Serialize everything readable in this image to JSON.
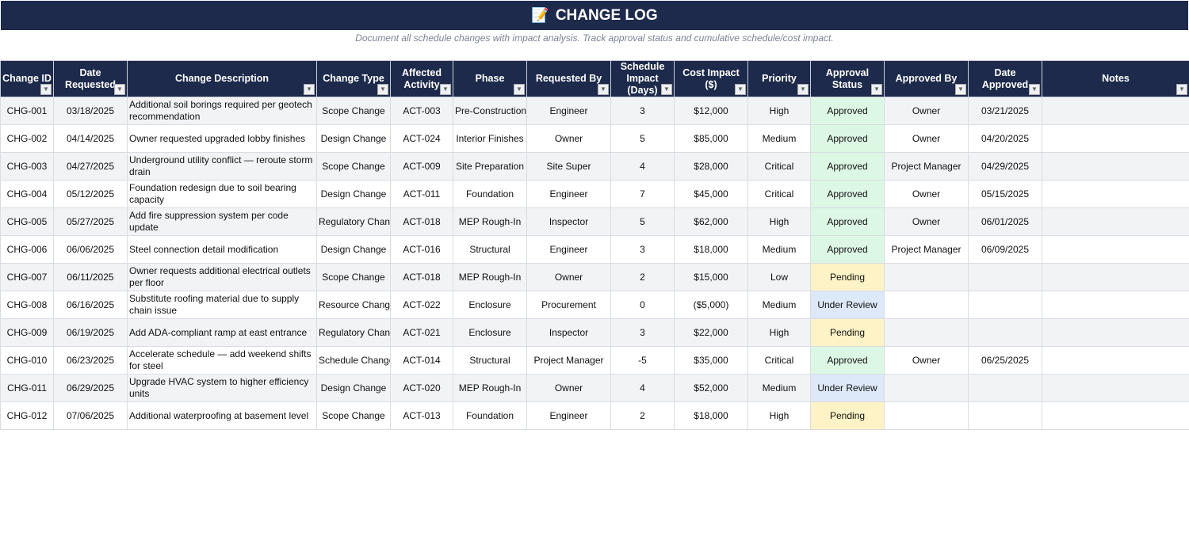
{
  "header": {
    "icon": "memo-icon",
    "title": "CHANGE LOG",
    "subtitle": "Document all schedule changes with impact analysis. Track approval status and cumulative schedule/cost impact."
  },
  "columns": [
    "Change ID",
    "Date Requested",
    "Change Description",
    "Change Type",
    "Affected Activity",
    "Phase",
    "Requested By",
    "Schedule Impact (Days)",
    "Cost Impact ($)",
    "Priority",
    "Approval Status",
    "Approved By",
    "Date Approved",
    "Notes"
  ],
  "status_colors": {
    "Approved": "#dcf7e4",
    "Pending": "#fdf3c6",
    "Under Review": "#dde8f8"
  },
  "rows": [
    [
      "CHG-001",
      "03/18/2025",
      "Additional soil borings required per geotech recommendation",
      "Scope Change",
      "ACT-003",
      "Pre-Construction",
      "Engineer",
      "3",
      "$12,000",
      "High",
      "Approved",
      "Owner",
      "03/21/2025",
      ""
    ],
    [
      "CHG-002",
      "04/14/2025",
      "Owner requested upgraded lobby finishes",
      "Design Change",
      "ACT-024",
      "Interior Finishes",
      "Owner",
      "5",
      "$85,000",
      "Medium",
      "Approved",
      "Owner",
      "04/20/2025",
      ""
    ],
    [
      "CHG-003",
      "04/27/2025",
      "Underground utility conflict — reroute storm drain",
      "Scope Change",
      "ACT-009",
      "Site Preparation",
      "Site Super",
      "4",
      "$28,000",
      "Critical",
      "Approved",
      "Project Manager",
      "04/29/2025",
      ""
    ],
    [
      "CHG-004",
      "05/12/2025",
      "Foundation redesign due to soil bearing capacity",
      "Design Change",
      "ACT-011",
      "Foundation",
      "Engineer",
      "7",
      "$45,000",
      "Critical",
      "Approved",
      "Owner",
      "05/15/2025",
      ""
    ],
    [
      "CHG-005",
      "05/27/2025",
      "Add fire suppression system per code update",
      "Regulatory Change",
      "ACT-018",
      "MEP Rough-In",
      "Inspector",
      "5",
      "$62,000",
      "High",
      "Approved",
      "Owner",
      "06/01/2025",
      ""
    ],
    [
      "CHG-006",
      "06/06/2025",
      "Steel connection detail modification",
      "Design Change",
      "ACT-016",
      "Structural",
      "Engineer",
      "3",
      "$18,000",
      "Medium",
      "Approved",
      "Project Manager",
      "06/09/2025",
      ""
    ],
    [
      "CHG-007",
      "06/11/2025",
      "Owner requests additional electrical outlets per floor",
      "Scope Change",
      "ACT-018",
      "MEP Rough-In",
      "Owner",
      "2",
      "$15,000",
      "Low",
      "Pending",
      "",
      "",
      ""
    ],
    [
      "CHG-008",
      "06/16/2025",
      "Substitute roofing material due to supply chain issue",
      "Resource Change",
      "ACT-022",
      "Enclosure",
      "Procurement",
      "0",
      "($5,000)",
      "Medium",
      "Under Review",
      "",
      "",
      ""
    ],
    [
      "CHG-009",
      "06/19/2025",
      "Add ADA-compliant ramp at east entrance",
      "Regulatory Change",
      "ACT-021",
      "Enclosure",
      "Inspector",
      "3",
      "$22,000",
      "High",
      "Pending",
      "",
      "",
      ""
    ],
    [
      "CHG-010",
      "06/23/2025",
      "Accelerate schedule — add weekend shifts for steel",
      "Schedule Change",
      "ACT-014",
      "Structural",
      "Project Manager",
      "-5",
      "$35,000",
      "Critical",
      "Approved",
      "Owner",
      "06/25/2025",
      ""
    ],
    [
      "CHG-011",
      "06/29/2025",
      "Upgrade HVAC system to higher efficiency units",
      "Design Change",
      "ACT-020",
      "MEP Rough-In",
      "Owner",
      "4",
      "$52,000",
      "Medium",
      "Under Review",
      "",
      "",
      ""
    ],
    [
      "CHG-012",
      "07/06/2025",
      "Additional waterproofing at basement level",
      "Scope Change",
      "ACT-013",
      "Foundation",
      "Engineer",
      "2",
      "$18,000",
      "High",
      "Pending",
      "",
      "",
      ""
    ]
  ]
}
